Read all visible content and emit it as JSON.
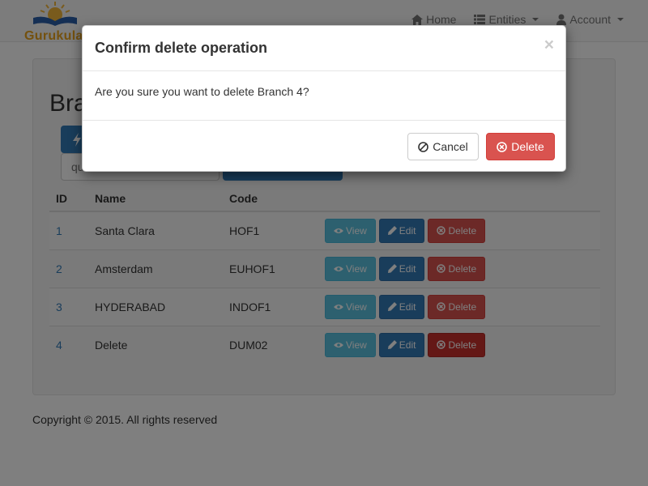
{
  "brand": {
    "name": "Gurukula",
    "accent": "#e8a21d"
  },
  "nav": {
    "home": "Home",
    "entities": "Entities",
    "account": "Account"
  },
  "page": {
    "title": "Bra",
    "query_placeholder": "qu"
  },
  "table": {
    "headers": {
      "id": "ID",
      "name": "Name",
      "code": "Code"
    },
    "rows": [
      {
        "id": "1",
        "name": "Santa Clara",
        "code": "HOF1"
      },
      {
        "id": "2",
        "name": "Amsterdam",
        "code": "EUHOF1"
      },
      {
        "id": "3",
        "name": "HYDERABAD",
        "code": "INDOF1"
      },
      {
        "id": "4",
        "name": "Delete",
        "code": "DUM02"
      }
    ],
    "actions": {
      "view": "View",
      "edit": "Edit",
      "delete": "Delete"
    }
  },
  "footer": {
    "copyright": "Copyright © 2015. All rights reserved"
  },
  "modal": {
    "title": "Confirm delete operation",
    "close": "×",
    "message": "Are you sure you want to delete Branch 4?",
    "cancel": "Cancel",
    "delete": "Delete"
  },
  "colors": {
    "primary": "#337ab7",
    "info": "#5bc0de",
    "danger": "#d9534f"
  }
}
